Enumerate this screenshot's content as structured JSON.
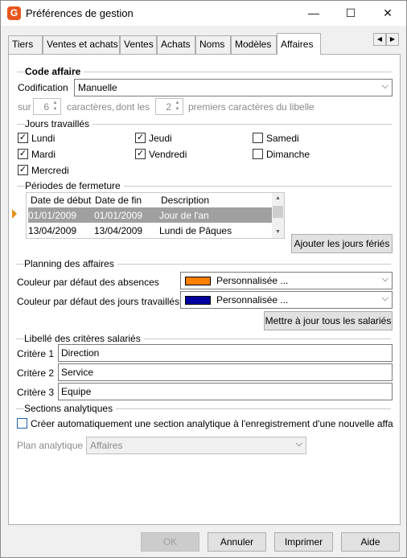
{
  "window": {
    "title": "Préférences de gestion",
    "app_icon": "G",
    "minimize": "—",
    "maximize": "☐",
    "close": "✕"
  },
  "tabs": [
    "Tiers",
    "Ventes et achats",
    "Ventes",
    "Achats",
    "Noms",
    "Modèles",
    "Affaires"
  ],
  "active_tab": "Affaires",
  "code_affaire": {
    "title": "Code affaire",
    "codification_label": "Codification",
    "codification_value": "Manuelle",
    "sur_label": "sur",
    "sur_value": "6",
    "caracteres_label": "caractères,",
    "dont_les_label": "dont les",
    "dont_value": "2",
    "premiers_label": "premiers caractères du libelle"
  },
  "jours": {
    "title": "Jours travaillés",
    "days": [
      {
        "label": "Lundi",
        "checked": true
      },
      {
        "label": "Mardi",
        "checked": true
      },
      {
        "label": "Mercredi",
        "checked": true
      },
      {
        "label": "Jeudi",
        "checked": true
      },
      {
        "label": "Vendredi",
        "checked": true
      },
      {
        "label": "Samedi",
        "checked": false
      },
      {
        "label": "Dimanche",
        "checked": false
      }
    ]
  },
  "periodes": {
    "title": "Périodes de fermeture",
    "columns": [
      "Date de début",
      "Date de fin",
      "Description"
    ],
    "rows": [
      {
        "debut": "01/01/2009",
        "fin": "01/01/2009",
        "desc": "Jour de l'an",
        "selected": true
      },
      {
        "debut": "13/04/2009",
        "fin": "13/04/2009",
        "desc": "Lundi de Pâques",
        "selected": false
      }
    ],
    "add_button": "Ajouter les jours fériés"
  },
  "planning": {
    "title": "Planning des affaires",
    "absences_label": "Couleur par défaut des absences",
    "absences_color": "#ff8000",
    "absences_value": "Personnalisée ...",
    "travailles_label": "Couleur par défaut des jours travaillés",
    "travailles_color": "#0000a0",
    "travailles_value": "Personnalisée ...",
    "update_button": "Mettre à jour tous les salariés"
  },
  "criteres": {
    "title": "Libellé des critères salariés",
    "items": [
      {
        "label": "Critère 1",
        "value": "Direction"
      },
      {
        "label": "Critère 2",
        "value": "Service"
      },
      {
        "label": "Critère 3",
        "value": "Equipe"
      }
    ]
  },
  "analytique": {
    "title": "Sections analytiques",
    "checkbox_label": "Créer automatiquement une section analytique à l'enregistrement d'une nouvelle affa",
    "checked": false,
    "plan_label": "Plan analytique",
    "plan_value": "Affaires"
  },
  "buttons": {
    "ok": "OK",
    "annuler": "Annuler",
    "imprimer": "Imprimer",
    "aide": "Aide"
  }
}
